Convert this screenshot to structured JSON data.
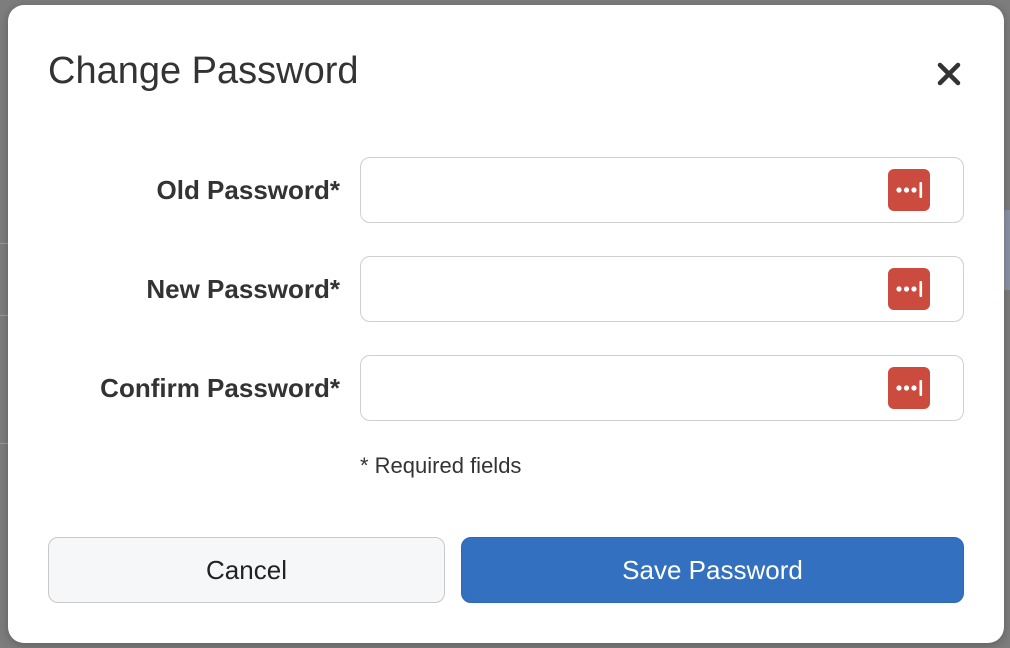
{
  "modal": {
    "title": "Change Password",
    "close_icon": "close-icon"
  },
  "fields": [
    {
      "label": "Old Password*",
      "value": "",
      "placeholder": "",
      "icon": "password-manager-icon"
    },
    {
      "label": "New Password*",
      "value": "",
      "placeholder": "",
      "icon": "password-manager-icon"
    },
    {
      "label": "Confirm Password*",
      "value": "",
      "placeholder": "",
      "icon": "password-manager-icon"
    }
  ],
  "required_note": "* Required fields",
  "buttons": {
    "cancel_label": "Cancel",
    "save_label": "Save Password"
  },
  "colors": {
    "primary": "#3370c0",
    "password_manager_icon": "#cc4b3f",
    "overlay": "#7d7d7d"
  }
}
